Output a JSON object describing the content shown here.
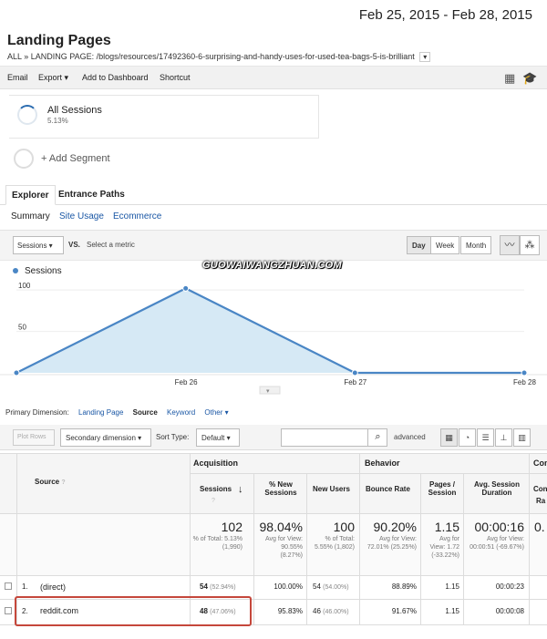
{
  "header": {
    "date_range": "Feb 25, 2015 - Feb 28, 2015",
    "title": "Landing Pages",
    "breadcrumb_all": "ALL",
    "breadcrumb_sep": "»",
    "breadcrumb_path": "LANDING PAGE: /blogs/resources/17492360-6-surprising-and-handy-uses-for-used-tea-bags-5-is-brilliant"
  },
  "toolbar": {
    "email": "Email",
    "export": "Export ▾",
    "add_to_dashboard": "Add to Dashboard",
    "shortcut": "Shortcut"
  },
  "segments": {
    "all_sessions": "All Sessions",
    "all_sessions_pct": "5.13%",
    "add_segment": "+ Add Segment"
  },
  "tabs": {
    "explorer": "Explorer",
    "entrance_paths": "Entrance Paths"
  },
  "subtabs": {
    "summary": "Summary",
    "site_usage": "Site Usage",
    "ecommerce": "Ecommerce"
  },
  "chart_controls": {
    "metric": "Sessions ▾",
    "vs": "VS.",
    "select_metric": "Select a metric",
    "day": "Day",
    "week": "Week",
    "month": "Month"
  },
  "watermark": "GUOWAIWANGZHUAN.COM",
  "chart_data": {
    "type": "area",
    "series": [
      {
        "name": "Sessions",
        "values": [
          0,
          102,
          0,
          0
        ]
      }
    ],
    "x_labels": [
      "Feb 26",
      "Feb 27",
      "Feb 28"
    ],
    "y_ticks": [
      "100",
      "50"
    ],
    "ylim": [
      0,
      120
    ],
    "color": "#4a86c5",
    "fill": "#d6e9f5"
  },
  "dimensions": {
    "label": "Primary Dimension:",
    "landing_page": "Landing Page",
    "source": "Source",
    "keyword": "Keyword",
    "other": "Other ▾"
  },
  "table_controls": {
    "plot_rows": "Plot Rows",
    "secondary_dimension": "Secondary dimension ▾",
    "sort_type": "Sort Type:",
    "sort_default": "Default ▾",
    "advanced": "advanced"
  },
  "table": {
    "group_acquisition": "Acquisition",
    "group_behavior": "Behavior",
    "group_conversions": "Con",
    "col_source": "Source",
    "col_sessions": "Sessions",
    "col_new_sessions": "% New Sessions",
    "col_new_users": "New Users",
    "col_bounce": "Bounce Rate",
    "col_pages": "Pages / Session",
    "col_duration": "Avg. Session Duration",
    "col_conv_a": "Con",
    "col_conv_b": "Ra",
    "totals": {
      "sessions": "102",
      "sessions_sub": "% of Total: 5.13% (1,990)",
      "new_sessions": "98.04%",
      "new_sessions_sub": "Avg for View: 90.55% (8.27%)",
      "new_users": "100",
      "new_users_sub": "% of Total: 5.55% (1,802)",
      "bounce": "90.20%",
      "bounce_sub": "Avg for View: 72.01% (25.25%)",
      "pages": "1.15",
      "pages_sub": "Avg for View: 1.72 (-33.22%)",
      "duration": "00:00:16",
      "duration_sub": "Avg for View: 00:00:51 (-69.67%)",
      "conv": "0."
    },
    "rows": [
      {
        "index": "1.",
        "source": "(direct)",
        "sessions": "54",
        "sessions_pct": "(52.94%)",
        "new_sessions": "100.00%",
        "new_users": "54",
        "new_users_pct": "(54.00%)",
        "bounce": "88.89%",
        "pages": "1.15",
        "duration": "00:00:23"
      },
      {
        "index": "2.",
        "source": "reddit.com",
        "sessions": "48",
        "sessions_pct": "(47.06%)",
        "new_sessions": "95.83%",
        "new_users": "46",
        "new_users_pct": "(46.00%)",
        "bounce": "91.67%",
        "pages": "1.15",
        "duration": "00:00:08"
      }
    ]
  }
}
